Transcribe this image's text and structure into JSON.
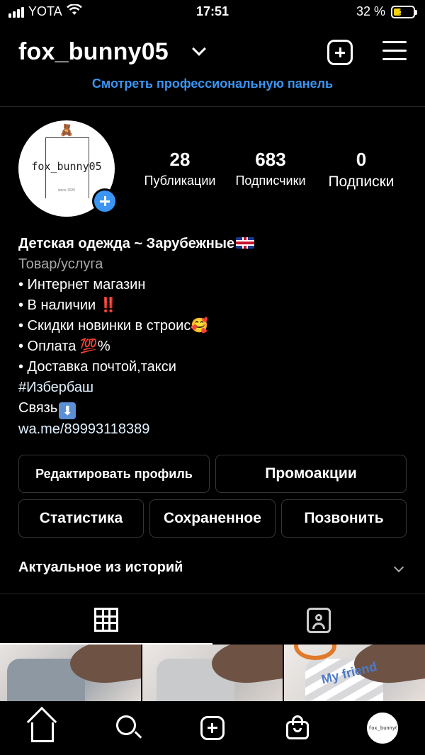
{
  "status_bar": {
    "carrier": "YOTA",
    "time": "17:51",
    "battery": "32 %"
  },
  "header": {
    "username": "fox_bunny05",
    "pro_dashboard_link": "Смотреть профессиональную панель"
  },
  "avatar": {
    "logo_text": "fox_bunny05",
    "logo_subtext": "since 2020"
  },
  "stats": [
    {
      "value": "28",
      "label": "Публикации"
    },
    {
      "value": "683",
      "label": "Подписчики"
    },
    {
      "value": "0",
      "label": "Подписки"
    }
  ],
  "bio": {
    "name": "Детская одежда ~ Зарубежные",
    "category": "Товар/услуга",
    "lines": [
      "• Интернет магазин",
      "• В наличии ‼️",
      "• Скидки новинки в строис🥰",
      "• Оплата 💯%",
      "• Доставка почтой,такси",
      "#Избербаш",
      "Связь"
    ],
    "link": "wa.me/89993118389"
  },
  "buttons": {
    "edit_profile": "Редактировать профиль",
    "promotions": "Промоакции",
    "statistics": "Статистика",
    "saved": "Сохраненное",
    "call": "Позвонить"
  },
  "highlights_title": "Актуальное из историй",
  "photos": {
    "p3_text": "My friend"
  },
  "icons": {
    "header": [
      "chevron-down-icon",
      "add-post-icon",
      "menu-icon"
    ],
    "tabs": [
      "grid-icon",
      "tagged-icon"
    ],
    "nav": [
      "home-icon",
      "search-icon",
      "create-icon",
      "shop-icon",
      "profile-avatar"
    ]
  },
  "colors": {
    "accent_blue": "#3a95f3",
    "background": "#000000",
    "button_border": "#363636"
  }
}
